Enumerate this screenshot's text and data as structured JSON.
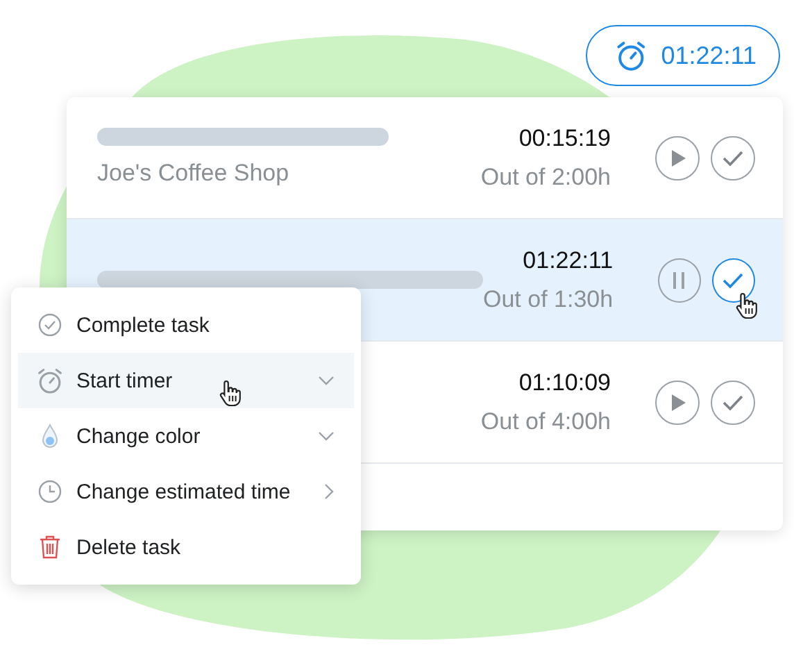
{
  "timer_badge": {
    "time": "01:22:11"
  },
  "tasks": [
    {
      "client": "Joe's Coffee Shop",
      "time": "00:15:19",
      "estimate": "Out of 2:00h",
      "running": false,
      "selected": false,
      "done_hover": false,
      "bar": true
    },
    {
      "time": "01:22:11",
      "estimate": "Out of 1:30h",
      "running": true,
      "selected": true,
      "done_hover": true,
      "bar": true
    },
    {
      "time": "01:10:09",
      "estimate": "Out of 4:00h",
      "running": false,
      "selected": false,
      "done_hover": false,
      "bar": false
    }
  ],
  "context_menu": [
    {
      "kind": "complete",
      "label": "Complete task",
      "expandable": false,
      "has_submenu": false,
      "selected": false
    },
    {
      "kind": "timer",
      "label": "Start timer",
      "expandable": true,
      "has_submenu": false,
      "selected": true
    },
    {
      "kind": "color",
      "label": "Change color",
      "expandable": true,
      "has_submenu": false,
      "selected": false
    },
    {
      "kind": "estimate",
      "label": "Change estimated time",
      "expandable": false,
      "has_submenu": true,
      "selected": false
    },
    {
      "kind": "delete",
      "label": "Delete task",
      "expandable": false,
      "has_submenu": false,
      "selected": false
    }
  ]
}
